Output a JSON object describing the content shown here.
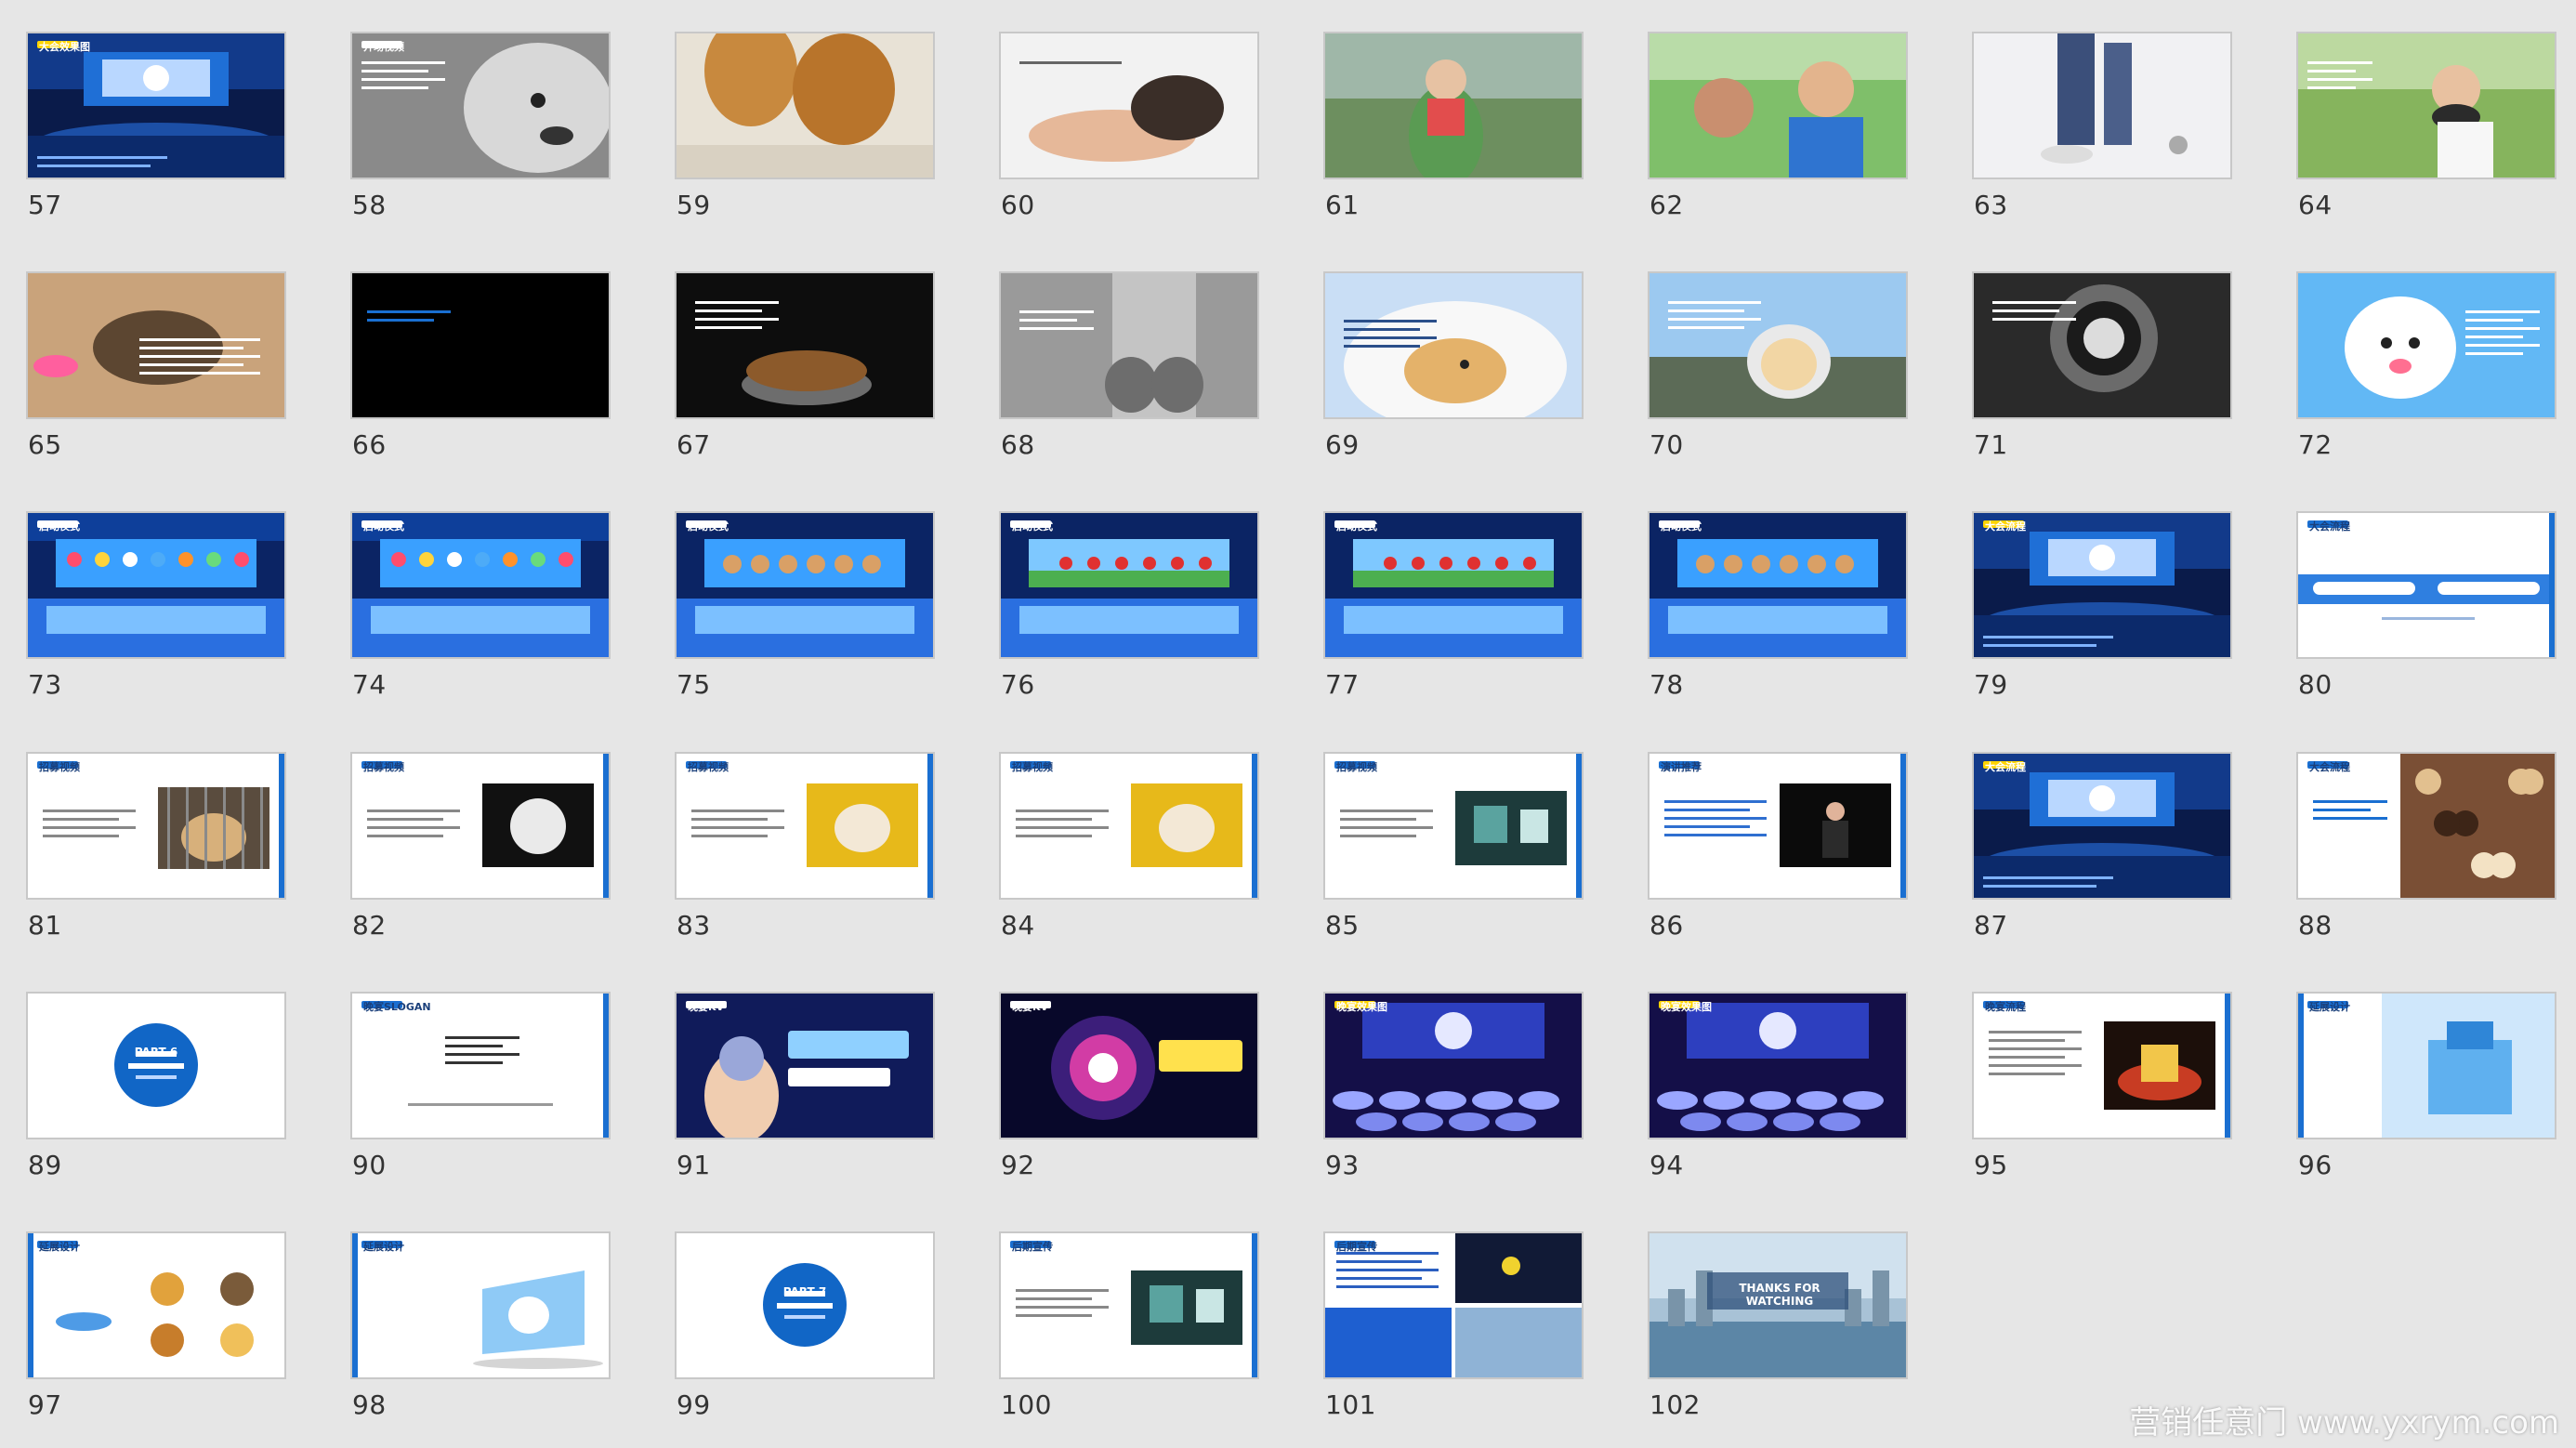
{
  "colors": {
    "background": "#e6e6e6",
    "accent_blue": "#1a6fd1",
    "dark_blue": "#0a1d4e",
    "slide_border": "#c8c8c8"
  },
  "watermark": "营销任意门 www.yxrym.com",
  "slides": [
    {
      "number": "57",
      "scene": "stage-hall",
      "label": "大会效果图",
      "text": ""
    },
    {
      "number": "58",
      "scene": "gray-dog",
      "label": "开场视频",
      "text": ""
    },
    {
      "number": "59",
      "scene": "paws-floor",
      "label": "",
      "text": ""
    },
    {
      "number": "60",
      "scene": "paw-hand",
      "label": "",
      "text": ""
    },
    {
      "number": "61",
      "scene": "photo-woman",
      "label": "",
      "text": ""
    },
    {
      "number": "62",
      "scene": "photo-kids",
      "label": "",
      "text": ""
    },
    {
      "number": "63",
      "scene": "photo-legs",
      "label": "",
      "text": ""
    },
    {
      "number": "64",
      "scene": "photo-girl",
      "label": "",
      "text": ""
    },
    {
      "number": "65",
      "scene": "sand-shadow",
      "label": "",
      "text": ""
    },
    {
      "number": "66",
      "scene": "black",
      "label": "",
      "text": ""
    },
    {
      "number": "67",
      "scene": "food-bowl",
      "label": "",
      "text": ""
    },
    {
      "number": "68",
      "scene": "gray-paws",
      "label": "",
      "text": ""
    },
    {
      "number": "69",
      "scene": "dog-cone",
      "label": "",
      "text": ""
    },
    {
      "number": "70",
      "scene": "dog-road",
      "label": "",
      "text": ""
    },
    {
      "number": "71",
      "scene": "dog-tunnel",
      "label": "",
      "text": ""
    },
    {
      "number": "72",
      "scene": "dog-blue",
      "label": "",
      "text": ""
    },
    {
      "number": "73",
      "scene": "stage-balloons",
      "label": "启动仪式",
      "text": ""
    },
    {
      "number": "74",
      "scene": "stage-balloons",
      "label": "启动仪式",
      "text": ""
    },
    {
      "number": "75",
      "scene": "stage-dogs",
      "label": "启动仪式",
      "text": ""
    },
    {
      "number": "76",
      "scene": "stage-field",
      "label": "启动仪式",
      "text": ""
    },
    {
      "number": "77",
      "scene": "stage-field",
      "label": "启动仪式",
      "text": ""
    },
    {
      "number": "78",
      "scene": "stage-dogs",
      "label": "启动仪式",
      "text": ""
    },
    {
      "number": "79",
      "scene": "stage-hall",
      "label": "大会流程",
      "text": ""
    },
    {
      "number": "80",
      "scene": "white-banner",
      "label": "大会流程",
      "text": ""
    },
    {
      "number": "81",
      "scene": "white-photo-cage",
      "label": "招募视频",
      "text": ""
    },
    {
      "number": "82",
      "scene": "white-photo-dark",
      "label": "招募视频",
      "text": ""
    },
    {
      "number": "83",
      "scene": "white-photo-yellow",
      "label": "招募视频",
      "text": ""
    },
    {
      "number": "84",
      "scene": "white-photo-yellow",
      "label": "招募视频",
      "text": ""
    },
    {
      "number": "85",
      "scene": "white-photo-hall",
      "label": "招募视频",
      "text": ""
    },
    {
      "number": "86",
      "scene": "white-photo-speaker",
      "label": "演讲推荐",
      "text": ""
    },
    {
      "number": "87",
      "scene": "stage-hall",
      "label": "大会流程",
      "text": ""
    },
    {
      "number": "88",
      "scene": "white-photo-cookies",
      "label": "大会流程",
      "text": ""
    },
    {
      "number": "89",
      "scene": "part-circle",
      "label": "PART 6",
      "text": ""
    },
    {
      "number": "90",
      "scene": "white-text",
      "label": "晚宴SLOGAN",
      "text": ""
    },
    {
      "number": "91",
      "scene": "kv-hand",
      "label": "晚宴KV",
      "text": ""
    },
    {
      "number": "92",
      "scene": "kv-burst",
      "label": "晚宴KV",
      "text": ""
    },
    {
      "number": "93",
      "scene": "banquet",
      "label": "晚宴效果图",
      "text": ""
    },
    {
      "number": "94",
      "scene": "banquet",
      "label": "晚宴效果图",
      "text": ""
    },
    {
      "number": "95",
      "scene": "white-photo-cake",
      "label": "晚宴流程",
      "text": ""
    },
    {
      "number": "96",
      "scene": "blue-box",
      "label": "延展设计",
      "text": ""
    },
    {
      "number": "97",
      "scene": "white-badges",
      "label": "延展设计",
      "text": ""
    },
    {
      "number": "98",
      "scene": "white-card",
      "label": "延展设计",
      "text": ""
    },
    {
      "number": "99",
      "scene": "part-circle",
      "label": "PART 7",
      "text": ""
    },
    {
      "number": "100",
      "scene": "white-photo-hall",
      "label": "后期宣传",
      "text": ""
    },
    {
      "number": "101",
      "scene": "collage",
      "label": "后期宣传",
      "text": ""
    },
    {
      "number": "102",
      "scene": "thanks",
      "label": "",
      "text": "THANKS FOR WATCHING"
    }
  ]
}
